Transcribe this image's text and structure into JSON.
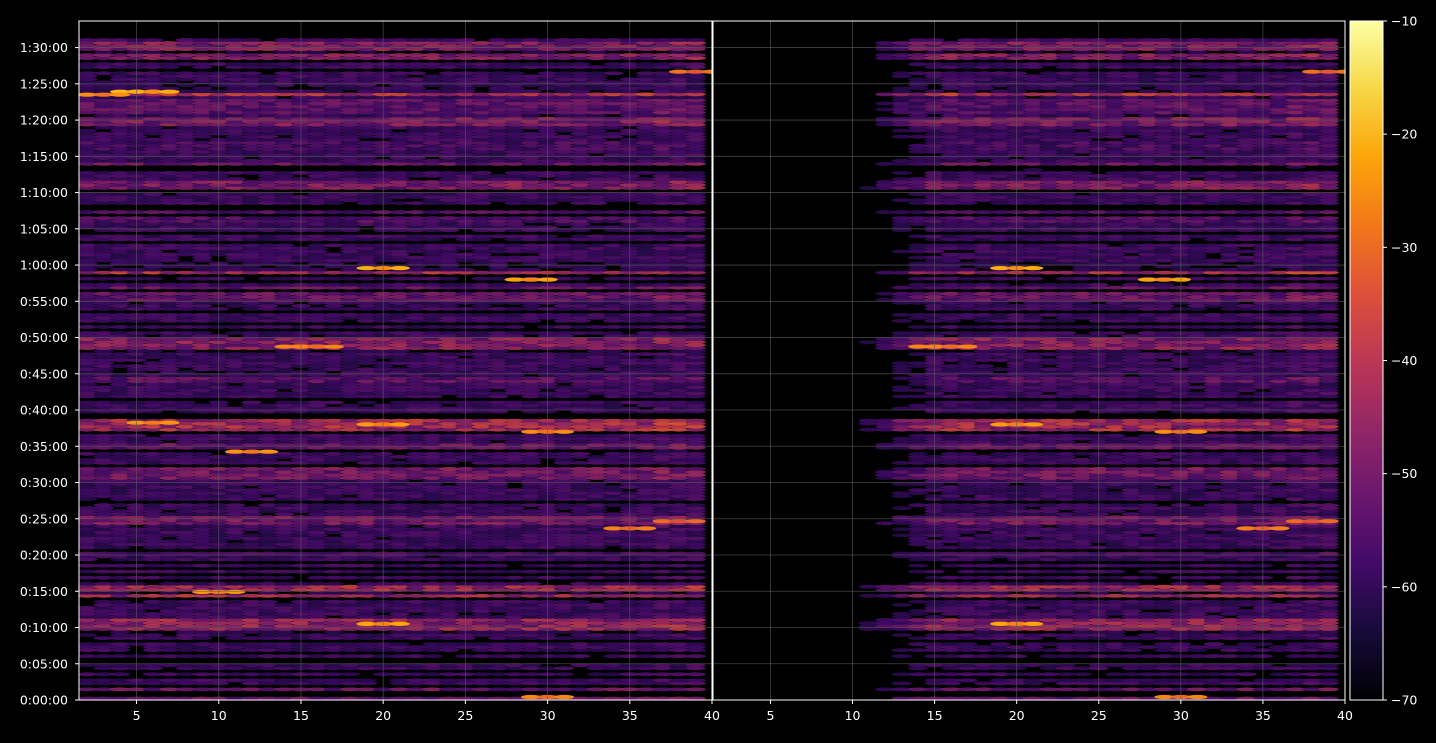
{
  "chart_data": {
    "type": "heatmap",
    "title": "",
    "xlabel": "",
    "ylabel": "",
    "grid": true,
    "background": "#000000",
    "grid_color": "#5a5a5a",
    "axis_color": "#ffffff",
    "colormap": "inferno",
    "panels": [
      {
        "name": "left",
        "x_ticks": [
          "5",
          "10",
          "15",
          "20",
          "25",
          "30",
          "35",
          "40"
        ],
        "x_tick_values": [
          5,
          10,
          15,
          20,
          25,
          30,
          35,
          40
        ],
        "xlim": [
          1.5,
          40
        ],
        "channel_range": [
          2,
          39
        ],
        "y_ticks": [
          "0:00:00",
          "0:05:00",
          "0:10:00",
          "0:15:00",
          "0:20:00",
          "0:25:00",
          "0:30:00",
          "0:35:00",
          "0:40:00",
          "0:45:00",
          "0:50:00",
          "0:55:00",
          "1:00:00",
          "1:05:00",
          "1:10:00",
          "1:15:00",
          "1:20:00",
          "1:25:00",
          "1:30:00"
        ],
        "y_tick_values": [
          0,
          300,
          600,
          900,
          1200,
          1500,
          1800,
          2100,
          2400,
          2700,
          3000,
          3300,
          3600,
          3900,
          4200,
          4500,
          4800,
          5100,
          5400
        ],
        "ylim": [
          0,
          5620
        ]
      },
      {
        "name": "right",
        "x_ticks": [
          "5",
          "10",
          "15",
          "20",
          "25",
          "30",
          "35",
          "40"
        ],
        "x_tick_values": [
          5,
          10,
          15,
          20,
          25,
          30,
          35,
          40
        ],
        "xlim": [
          1.5,
          40
        ],
        "channel_range": [
          7,
          39
        ],
        "ylim": [
          0,
          5620
        ]
      }
    ],
    "colorbar": {
      "ticks": [
        "−10",
        "−20",
        "−30",
        "−40",
        "−50",
        "−60",
        "−70"
      ],
      "tick_values": [
        -10,
        -20,
        -30,
        -40,
        -50,
        -60,
        -70
      ],
      "range": [
        -70,
        -10
      ]
    },
    "hot_spots": [
      {
        "channel": 5,
        "time": 5035,
        "value": -24
      },
      {
        "channel": 6,
        "time": 5035,
        "value": -25
      },
      {
        "channel": 20,
        "time": 3575,
        "value": -25
      },
      {
        "channel": 29,
        "time": 3480,
        "value": -26
      },
      {
        "channel": 20,
        "time": 630,
        "value": -26
      },
      {
        "channel": 30,
        "time": 2220,
        "value": -29
      },
      {
        "channel": 12,
        "time": 2055,
        "value": -28
      },
      {
        "channel": 20,
        "time": 2280,
        "value": -27
      },
      {
        "channel": 15,
        "time": 2925,
        "value": -30
      },
      {
        "channel": 16,
        "time": 2925,
        "value": -30
      },
      {
        "channel": 10,
        "time": 895,
        "value": -27
      },
      {
        "channel": 6,
        "time": 2295,
        "value": -28
      },
      {
        "channel": 3,
        "time": 5010,
        "value": -29
      },
      {
        "channel": 35,
        "time": 1420,
        "value": -31
      },
      {
        "channel": 30,
        "time": 25,
        "value": -30
      },
      {
        "channel": 38,
        "time": 1480,
        "value": -34
      },
      {
        "channel": 39,
        "time": 5200,
        "value": -33
      }
    ]
  }
}
